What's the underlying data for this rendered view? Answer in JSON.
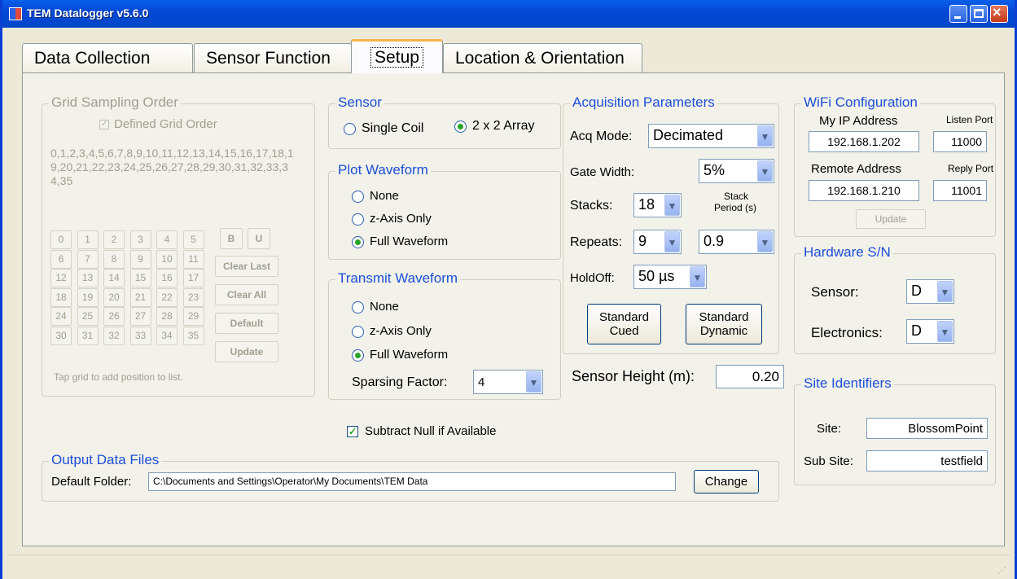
{
  "window": {
    "title": "TEM Datalogger v5.6.0"
  },
  "tabs": [
    "Data Collection",
    "Sensor Function",
    "Setup",
    "Location & Orientation"
  ],
  "grid": {
    "title": "Grid Sampling Order",
    "defined_label": "Defined Grid Order",
    "order_text": "0,1,2,3,4,5,6,7,8,9,10,11,12,13,14,15,16,17,18,19,20,21,22,23,24,25,26,27,28,29,30,31,32,33,34,35",
    "cells": [
      "0",
      "1",
      "2",
      "3",
      "4",
      "5",
      "6",
      "7",
      "8",
      "9",
      "10",
      "11",
      "12",
      "13",
      "14",
      "15",
      "16",
      "17",
      "18",
      "19",
      "20",
      "21",
      "22",
      "23",
      "24",
      "25",
      "26",
      "27",
      "28",
      "29",
      "30",
      "31",
      "32",
      "33",
      "34",
      "35"
    ],
    "b_label": "B",
    "u_label": "U",
    "clear_last": "Clear Last",
    "clear_all": "Clear All",
    "default": "Default",
    "update": "Update",
    "hint": "Tap grid to add position to list."
  },
  "sensor": {
    "title": "Sensor",
    "single": "Single Coil",
    "array": "2 x 2 Array"
  },
  "plot": {
    "title": "Plot Waveform",
    "none": "None",
    "zaxis": "z-Axis Only",
    "full": "Full Waveform"
  },
  "transmit": {
    "title": "Transmit Waveform",
    "none": "None",
    "zaxis": "z-Axis Only",
    "full": "Full Waveform",
    "sparsing_label": "Sparsing Factor:",
    "sparsing": "4"
  },
  "subtract": {
    "label": "Subtract Null if Available",
    "checked": true
  },
  "acq": {
    "title": "Acquisition Parameters",
    "mode_label": "Acq Mode:",
    "mode": "Decimated",
    "gate_label": "Gate Width:",
    "gate": "5%",
    "stacks_label": "Stacks:",
    "stacks": "18",
    "period_label1": "Stack",
    "period_label2": "Period (s)",
    "repeats_label": "Repeats:",
    "repeats": "9",
    "period": "0.9",
    "holdoff_label": "HoldOff:",
    "holdoff": "50 µs",
    "cued1": "Standard",
    "cued2": "Cued",
    "dyn1": "Standard",
    "dyn2": "Dynamic"
  },
  "height": {
    "label": "Sensor Height (m):",
    "value": "0.20"
  },
  "wifi": {
    "title": "WiFi Configuration",
    "my_ip_label": "My IP Address",
    "my_ip": "192.168.1.202",
    "listen_label": "Listen Port",
    "listen": "11000",
    "remote_label": "Remote Address",
    "remote": "192.168.1.210",
    "reply_label": "Reply Port",
    "reply": "11001",
    "update": "Update"
  },
  "hw": {
    "title": "Hardware S/N",
    "sensor_label": "Sensor:",
    "sensor": "D",
    "elec_label": "Electronics:",
    "elec": "D"
  },
  "site": {
    "title": "Site Identifiers",
    "site_label": "Site:",
    "site": "BlossomPoint",
    "sub_label": "Sub Site:",
    "sub": "testfield"
  },
  "output": {
    "title": "Output Data Files",
    "folder_label": "Default Folder:",
    "folder": "C:\\Documents and Settings\\Operator\\My Documents\\TEM Data",
    "change": "Change"
  }
}
